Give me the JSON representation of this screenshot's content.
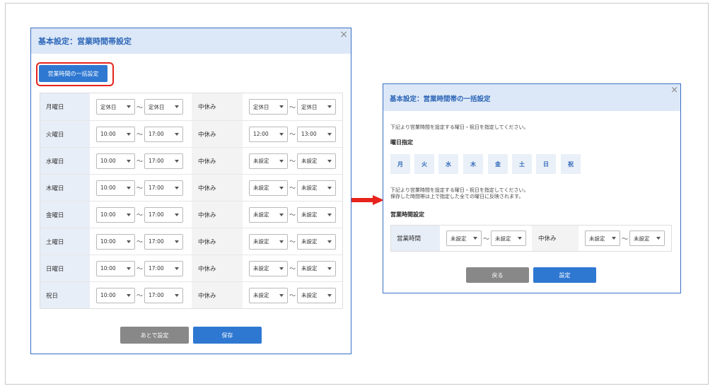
{
  "left_dialog": {
    "title": "基本設定：営業時間帯設定",
    "close": "×",
    "bulk_button": "営業時間の一括設定",
    "rows": [
      {
        "day": "月曜日",
        "start": "定休日",
        "end": "定休日",
        "break_label": "中休み",
        "break_start": "定休日",
        "break_end": "定休日"
      },
      {
        "day": "火曜日",
        "start": "10:00",
        "end": "17:00",
        "break_label": "中休み",
        "break_start": "12:00",
        "break_end": "13:00"
      },
      {
        "day": "水曜日",
        "start": "10:00",
        "end": "17:00",
        "break_label": "中休み",
        "break_start": "未設定",
        "break_end": "未設定"
      },
      {
        "day": "木曜日",
        "start": "10:00",
        "end": "17:00",
        "break_label": "中休み",
        "break_start": "未設定",
        "break_end": "未設定"
      },
      {
        "day": "金曜日",
        "start": "10:00",
        "end": "17:00",
        "break_label": "中休み",
        "break_start": "未設定",
        "break_end": "未設定"
      },
      {
        "day": "土曜日",
        "start": "10:00",
        "end": "17:00",
        "break_label": "中休み",
        "break_start": "未設定",
        "break_end": "未設定"
      },
      {
        "day": "日曜日",
        "start": "10:00",
        "end": "17:00",
        "break_label": "中休み",
        "break_start": "未設定",
        "break_end": "未設定"
      },
      {
        "day": "祝日",
        "start": "10:00",
        "end": "17:00",
        "break_label": "中休み",
        "break_start": "未設定",
        "break_end": "未設定"
      }
    ],
    "tilde": "〜",
    "later_button": "あとで設定",
    "save_button": "保存"
  },
  "right_dialog": {
    "title": "基本設定：営業時間帯の一括設定",
    "close": "×",
    "note1": "下記より営業時間を設定する曜日・祝日を指定してください。",
    "day_section_title": "曜日指定",
    "days": [
      "月",
      "火",
      "水",
      "木",
      "金",
      "土",
      "日",
      "祝"
    ],
    "note2_line1": "下記より営業時間を設定する曜日・祝日を指定してください。",
    "note2_line2": "保存した時間帯は上で指定した全ての曜日に反映されます。",
    "hours_section_title": "営業時間設定",
    "hours_label": "営業時間",
    "hours_start": "未設定",
    "hours_end": "未設定",
    "break_label": "中休み",
    "break_start": "未設定",
    "break_end": "未設定",
    "tilde": "〜",
    "back_button": "戻る",
    "set_button": "設定"
  },
  "colors": {
    "accent": "#2f78d2",
    "highlight": "#e6231c",
    "header_bg": "#dce8f7"
  }
}
